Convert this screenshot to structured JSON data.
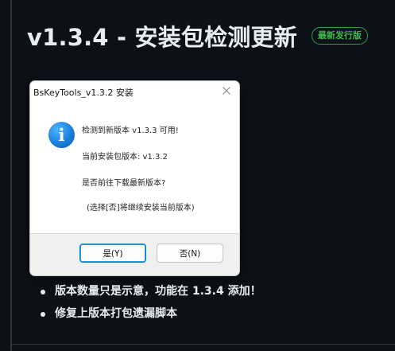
{
  "release": {
    "heading": "v1.3.4 - 安装包检测更新",
    "badge": "最新发行版",
    "notes": [
      "版本数量只是示意，功能在 1.3.4 添加！",
      "修复上版本打包遗漏脚本"
    ]
  },
  "dialog": {
    "title": "BsKeyTools_v1.3.2 安装",
    "messages": [
      "检测到新版本 v1.3.3 可用!",
      "当前安装包版本: v1.3.2",
      "是否前往下载最新版本?",
      "(选择[否]将继续安装当前版本)"
    ],
    "icon_glyph": "i",
    "buttons": {
      "yes": "是(Y)",
      "no": "否(N)"
    }
  },
  "colors": {
    "page_bg": "#0d1117",
    "badge": "#3fb950",
    "accent": "#0f7cb8"
  }
}
